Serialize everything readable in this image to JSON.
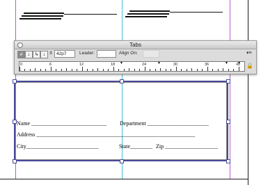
{
  "panel": {
    "title": "Tabs",
    "x_label": "X",
    "x_value": "42p7",
    "leader_label": "Leader:",
    "leader_value": ".",
    "align_on_label": "Align On:",
    "align_buttons": [
      "left-justified-tab",
      "center-justified-tab",
      "right-justified-tab",
      "decimal-tab"
    ],
    "ruler_labels": [
      "0",
      "6",
      "12",
      "18",
      "24",
      "30",
      "36",
      "42"
    ]
  },
  "form": {
    "line1_name": "Name ___________________________",
    "line1_dept": "Department ______________________",
    "line2": "Address _________________________________________________________",
    "line3_city": "City__________________________",
    "line3_state": "State________",
    "line3_zip": "Zip ___________________"
  },
  "colors": {
    "margin_guide": "#b85cc8",
    "ruler_guide": "#3fc3d6",
    "frame_border": "#4a4a9a"
  }
}
